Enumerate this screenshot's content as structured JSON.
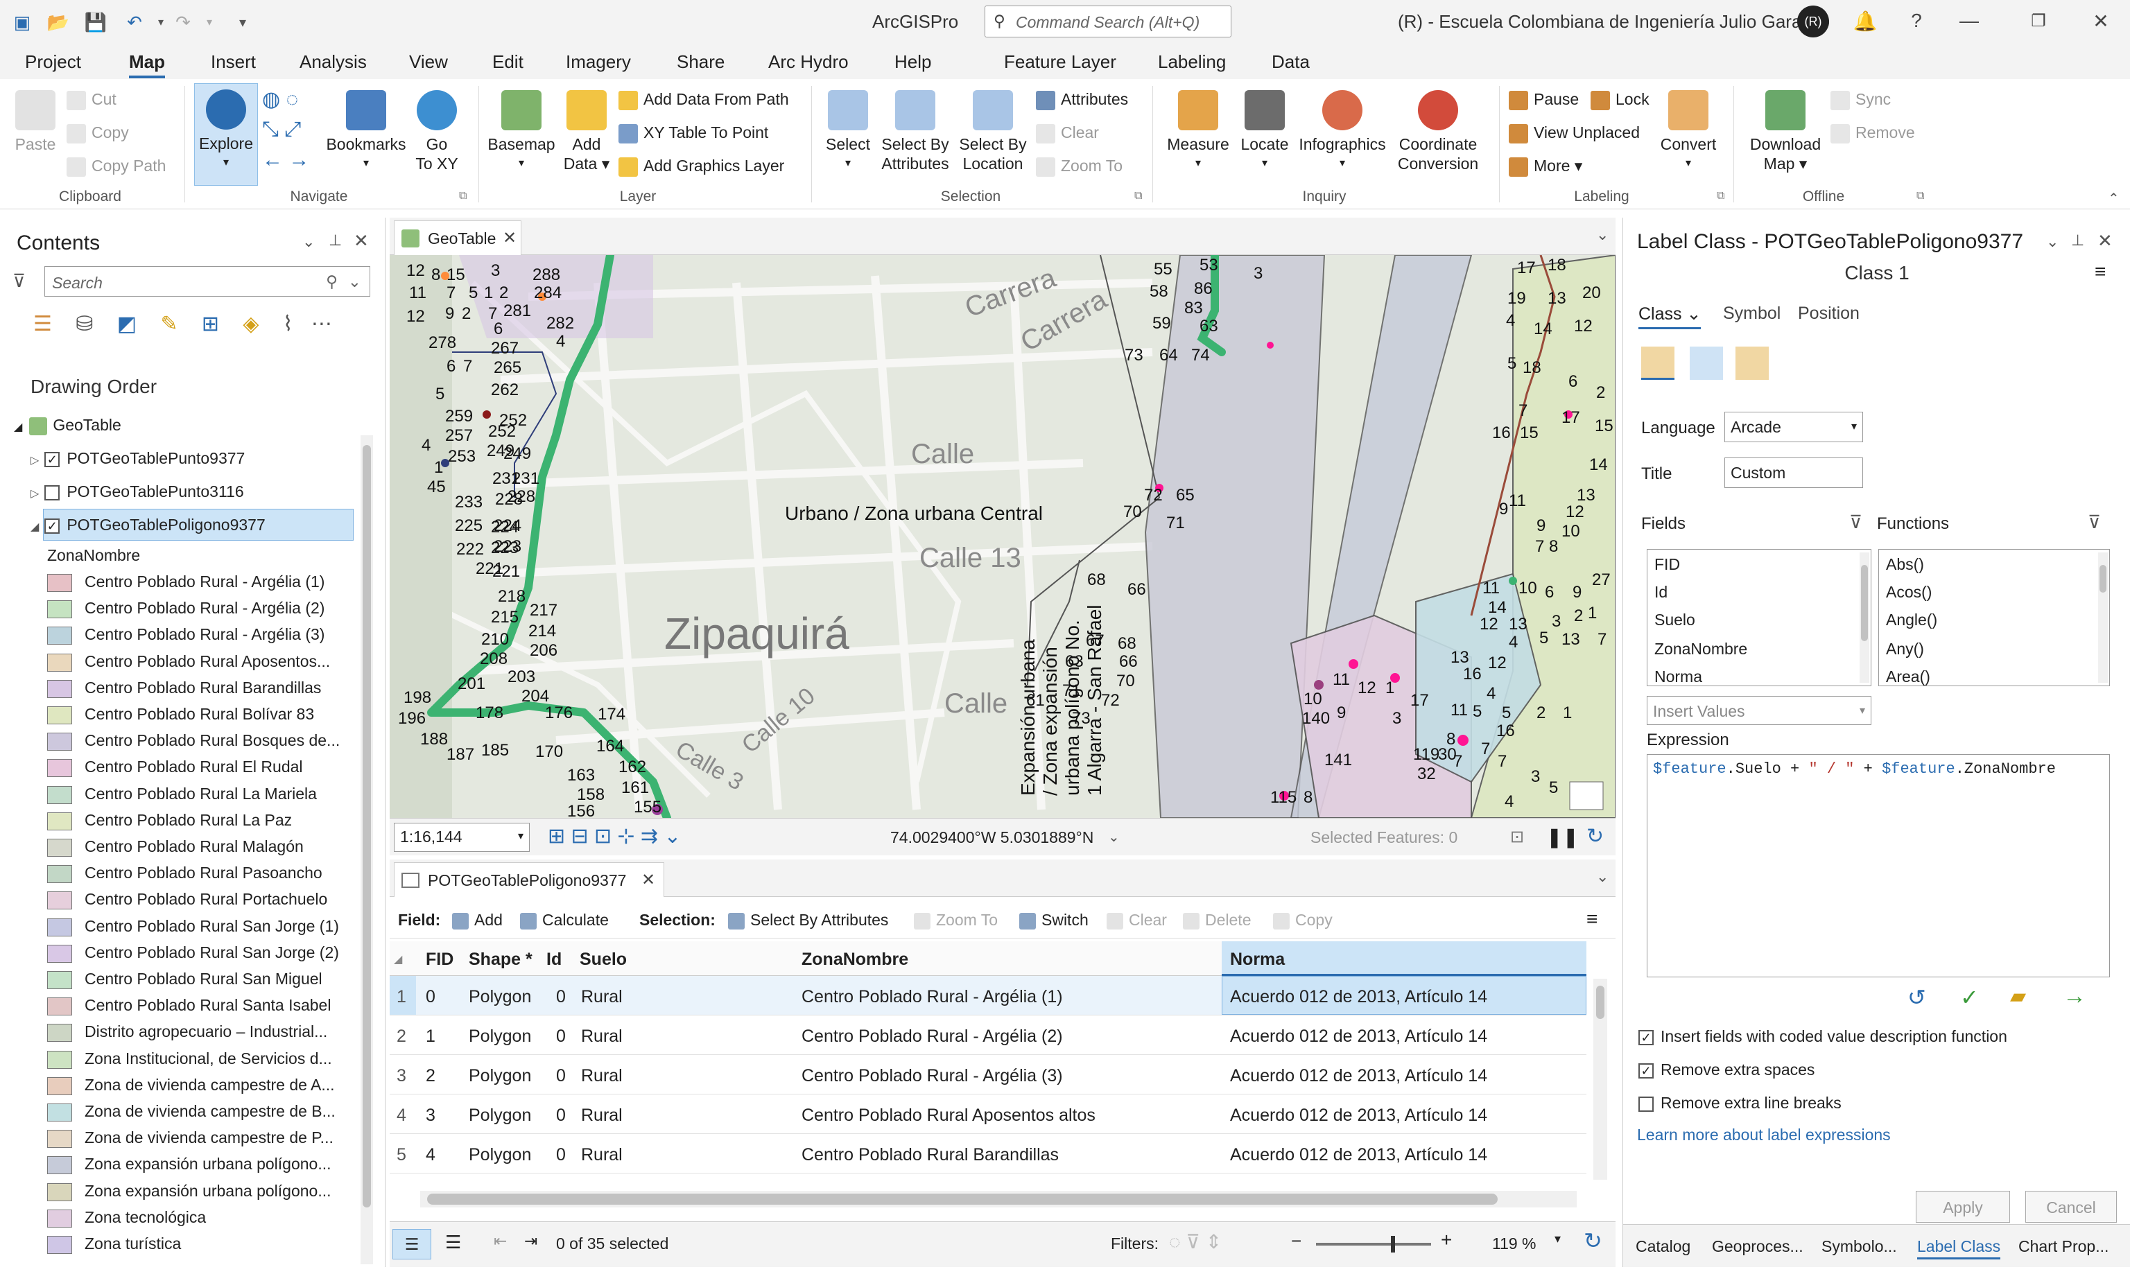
{
  "app": {
    "title": "ArcGISPro",
    "command_search_placeholder": "Command Search (Alt+Q)",
    "org": "(R) - Escuela Colombiana de Ingeniería Julio Garavito",
    "avatar": "(R)"
  },
  "tabs": [
    "Project",
    "Map",
    "Insert",
    "Analysis",
    "View",
    "Edit",
    "Imagery",
    "Share",
    "Arc Hydro",
    "Help",
    "Feature Layer",
    "Labeling",
    "Data"
  ],
  "ribbon": {
    "clipboard": {
      "paste": "Paste",
      "cut": "Cut",
      "copy": "Copy",
      "copy_path": "Copy Path",
      "group": "Clipboard"
    },
    "navigate": {
      "explore": "Explore",
      "bookmarks": "Bookmarks",
      "go_to_xy_1": "Go",
      "go_to_xy_2": "To XY",
      "group": "Navigate"
    },
    "layer": {
      "basemap": "Basemap",
      "add_data_1": "Add",
      "add_data_2": "Data",
      "add_from_path": "Add Data From Path",
      "xy_table": "XY Table To Point",
      "add_graphics": "Add Graphics Layer",
      "group": "Layer"
    },
    "selection": {
      "select": "Select",
      "by_attr_1": "Select By",
      "by_attr_2": "Attributes",
      "by_loc_1": "Select By",
      "by_loc_2": "Location",
      "attributes": "Attributes",
      "clear": "Clear",
      "zoom_to": "Zoom To",
      "group": "Selection"
    },
    "inquiry": {
      "measure": "Measure",
      "locate": "Locate",
      "infographics": "Infographics",
      "coord_1": "Coordinate",
      "coord_2": "Conversion",
      "group": "Inquiry"
    },
    "labeling": {
      "pause": "Pause",
      "lock": "Lock",
      "view_unplaced": "View Unplaced",
      "more": "More",
      "convert": "Convert",
      "group": "Labeling"
    },
    "offline": {
      "download_1": "Download",
      "download_2": "Map",
      "sync": "Sync",
      "remove": "Remove",
      "group": "Offline"
    }
  },
  "contents": {
    "title": "Contents",
    "search_placeholder": "Search",
    "drawing_order": "Drawing Order",
    "map_name": "GeoTable",
    "layers": [
      {
        "name": "POTGeoTablePunto9377",
        "checked": true
      },
      {
        "name": "POTGeoTablePunto3116",
        "checked": false
      },
      {
        "name": "POTGeoTablePoligono9377",
        "checked": true
      }
    ],
    "field_name": "ZonaNombre",
    "legend": [
      {
        "label": "Centro Poblado Rural - Argélia (1)",
        "color": "#e7c1c6"
      },
      {
        "label": "Centro Poblado Rural - Argélia (2)",
        "color": "#c5e3c1"
      },
      {
        "label": "Centro Poblado Rural - Argélia (3)",
        "color": "#bcd3dd"
      },
      {
        "label": "Centro Poblado Rural Aposentos...",
        "color": "#ead8bd"
      },
      {
        "label": "Centro Poblado Rural Barandillas",
        "color": "#d7c6e4"
      },
      {
        "label": "Centro Poblado Rural Bolívar 83",
        "color": "#dfe7c0"
      },
      {
        "label": "Centro Poblado Rural Bosques de...",
        "color": "#cdc8dd"
      },
      {
        "label": "Centro Poblado Rural El Rudal",
        "color": "#e7c6dc"
      },
      {
        "label": "Centro Poblado Rural La Mariela",
        "color": "#c3ddcc"
      },
      {
        "label": "Centro Poblado Rural La Paz",
        "color": "#e0e7c2"
      },
      {
        "label": "Centro Poblado Rural Malagón",
        "color": "#d6d8cc"
      },
      {
        "label": "Centro Poblado Rural Pasoancho",
        "color": "#c2d7c6"
      },
      {
        "label": "Centro Poblado Rural Portachuelo",
        "color": "#e6cfdc"
      },
      {
        "label": "Centro Poblado Rural San Jorge (1)",
        "color": "#c5c8e2"
      },
      {
        "label": "Centro Poblado Rural San Jorge (2)",
        "color": "#d9c8e6"
      },
      {
        "label": "Centro Poblado Rural San Miguel",
        "color": "#c4e2c8"
      },
      {
        "label": "Centro Poblado Rural Santa Isabel",
        "color": "#e2c6c6"
      },
      {
        "label": "Distrito agropecuario – Industrial...",
        "color": "#cdd6c5"
      },
      {
        "label": "Zona Institucional, de Servicios d...",
        "color": "#cde3c2"
      },
      {
        "label": "Zona de vivienda campestre de A...",
        "color": "#e8cdbd"
      },
      {
        "label": "Zona de vivienda campestre de B...",
        "color": "#c2e0e2"
      },
      {
        "label": "Zona de vivienda campestre de P...",
        "color": "#e6d8c6"
      },
      {
        "label": "Zona expansión urbana polígono...",
        "color": "#c6cbd9"
      },
      {
        "label": "Zona expansión urbana polígono...",
        "color": "#d9d6bb"
      },
      {
        "label": "Zona tecnológica",
        "color": "#e1cde0"
      },
      {
        "label": "Zona turística",
        "color": "#cfc6e6"
      }
    ]
  },
  "map": {
    "tab": "GeoTable",
    "city": "Zipaquirá",
    "streets": [
      "Carrera",
      "Carrera",
      "Calle",
      "Calle 13",
      "Calle",
      "Calle 3",
      "Calle 10"
    ],
    "labels": {
      "central": "Urbano / Zona urbana Central",
      "expansion": [
        "Expansión urbana",
        "/ Zona expansión",
        "urbana polígono No.",
        "1 Algarra - San Rafael"
      ]
    },
    "scale": "1:16,144",
    "coords": "74.0029400°W 5.0301889°N",
    "selected_features": "Selected Features: 0"
  },
  "table": {
    "tab": "POTGeoTablePoligono9377",
    "field_label": "Field:",
    "add": "Add",
    "calculate": "Calculate",
    "selection_label": "Selection:",
    "select_by_attributes": "Select By Attributes",
    "zoom_to": "Zoom To",
    "switch": "Switch",
    "clear": "Clear",
    "delete": "Delete",
    "copy": "Copy",
    "columns": [
      "FID",
      "Shape *",
      "Id",
      "Suelo",
      "ZonaNombre",
      "Norma"
    ],
    "rows": [
      [
        "1",
        "0",
        "Polygon",
        "0",
        "Rural",
        "Centro Poblado Rural - Argélia (1)",
        "Acuerdo 012 de 2013, Artículo 14"
      ],
      [
        "2",
        "1",
        "Polygon",
        "0",
        "Rural",
        "Centro Poblado Rural - Argélia (2)",
        "Acuerdo 012 de 2013, Artículo 14"
      ],
      [
        "3",
        "2",
        "Polygon",
        "0",
        "Rural",
        "Centro Poblado Rural - Argélia (3)",
        "Acuerdo 012 de 2013, Artículo 14"
      ],
      [
        "4",
        "3",
        "Polygon",
        "0",
        "Rural",
        "Centro Poblado Rural Aposentos altos",
        "Acuerdo 012 de 2013, Artículo 14"
      ],
      [
        "5",
        "4",
        "Polygon",
        "0",
        "Rural",
        "Centro Poblado Rural Barandillas",
        "Acuerdo 012 de 2013, Artículo 14"
      ]
    ],
    "selected": "0 of 35 selected",
    "filters": "Filters:",
    "zoom": "119 %"
  },
  "label_class": {
    "title": "Label Class - POTGeoTablePoligono9377",
    "class_name": "Class 1",
    "tabs": [
      "Class",
      "Symbol",
      "Position"
    ],
    "language_label": "Language",
    "language_value": "Arcade",
    "title_label": "Title",
    "title_value": "Custom",
    "fields_label": "Fields",
    "functions_label": "Functions",
    "fields": [
      "FID",
      "Id",
      "Suelo",
      "ZonaNombre",
      "Norma"
    ],
    "functions": [
      "Abs()",
      "Acos()",
      "Angle()",
      "Any()",
      "Area()"
    ],
    "insert_values": "Insert Values",
    "expression_label": "Expression",
    "expr": {
      "p1": "$feature",
      "p2": ".Suelo + ",
      "p3": "\" / \"",
      "p4": " + ",
      "p5": "$feature",
      "p6": ".ZonaNombre"
    },
    "opt1": "Insert fields with coded value description function",
    "opt2": "Remove extra spaces",
    "opt3": "Remove extra line breaks",
    "learn_more": "Learn more about label expressions",
    "apply": "Apply",
    "cancel": "Cancel",
    "bottom_tabs": [
      "Catalog",
      "Geoproces...",
      "Symbolo...",
      "Label Class",
      "Chart Prop..."
    ]
  }
}
